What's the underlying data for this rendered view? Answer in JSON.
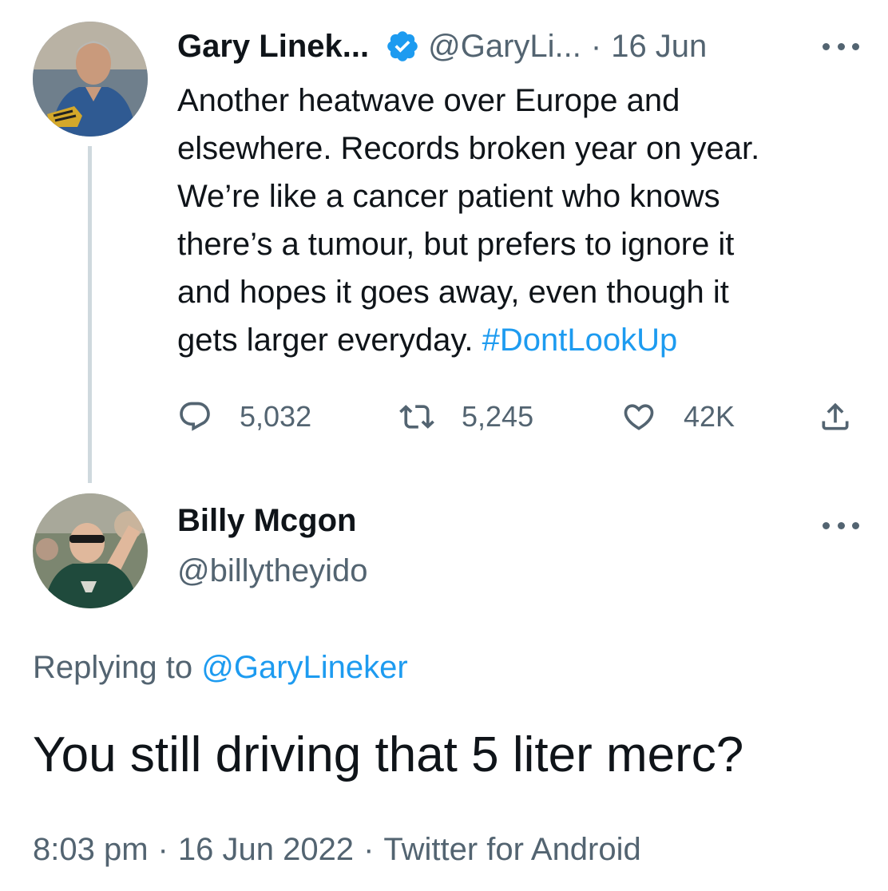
{
  "original_tweet": {
    "author_name": "Gary Linek...",
    "handle": "@GaryLi...",
    "separator": "·",
    "date": "16 Jun",
    "verified": true,
    "text_lines": [
      "Another heatwave over Europe and",
      "elsewhere. Records broken year on year.",
      "We’re like a cancer patient who knows",
      "there’s a tumour, but prefers to ignore it",
      "and hopes it goes away, even though it",
      "gets larger everyday. "
    ],
    "hashtag": "#DontLookUp",
    "actions": {
      "replies": "5,032",
      "retweets": "5,245",
      "likes": "42K"
    },
    "icons": {
      "reply": "speech-bubble-icon",
      "retweet": "retweet-arrows-icon",
      "like": "heart-icon",
      "share": "share-upload-icon",
      "more": "more-dots-icon",
      "verified": "verified-badge-icon"
    }
  },
  "reply_tweet": {
    "author_name": "Billy Mcgon",
    "handle": "@billytheyido",
    "replying_prefix": "Replying to ",
    "replying_to": "@GaryLineker",
    "text": "You still driving that 5 liter merc?",
    "time": "8:03 pm",
    "separator": "·",
    "date": "16 Jun 2022",
    "source": "Twitter for Android"
  },
  "colors": {
    "text_primary": "#0f1419",
    "text_secondary": "#536471",
    "accent_blue": "#1d9bf0",
    "thread_line": "#cfd9de"
  }
}
